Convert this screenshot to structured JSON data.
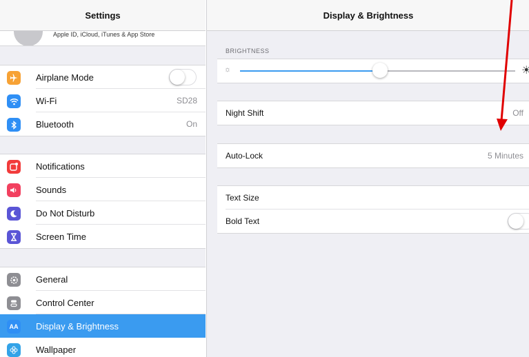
{
  "sidebar": {
    "title": "Settings",
    "profile_subtitle": "Apple ID, iCloud, iTunes & App Store",
    "groups": [
      {
        "items": [
          {
            "label": "Airplane Mode",
            "icon": "airplane-icon",
            "icon_color": "#f7a235",
            "toggle": false
          },
          {
            "label": "Wi-Fi",
            "icon": "wifi-icon",
            "icon_color": "#2f8ff5",
            "value": "SD28"
          },
          {
            "label": "Bluetooth",
            "icon": "bluetooth-icon",
            "icon_color": "#2f8ff5",
            "value": "On"
          }
        ]
      },
      {
        "items": [
          {
            "label": "Notifications",
            "icon": "notifications-icon",
            "icon_color": "#f23b3b"
          },
          {
            "label": "Sounds",
            "icon": "sounds-icon",
            "icon_color": "#f2405f"
          },
          {
            "label": "Do Not Disturb",
            "icon": "moon-icon",
            "icon_color": "#5a55d6"
          },
          {
            "label": "Screen Time",
            "icon": "hourglass-icon",
            "icon_color": "#5a55d6"
          }
        ]
      },
      {
        "items": [
          {
            "label": "General",
            "icon": "gear-icon",
            "icon_color": "#8e8e93"
          },
          {
            "label": "Control Center",
            "icon": "switches-icon",
            "icon_color": "#8e8e93"
          },
          {
            "label": "Display & Brightness",
            "icon": "text-size-icon",
            "icon_color": "#2f8ff5",
            "selected": true,
            "icon_glyph": "AA"
          },
          {
            "label": "Wallpaper",
            "icon": "flower-icon",
            "icon_color": "#33a3e8"
          }
        ]
      }
    ]
  },
  "detail": {
    "title": "Display & Brightness",
    "brightness_label": "BRIGHTNESS",
    "brightness_level": 0.51,
    "night_shift": {
      "label": "Night Shift",
      "value": "Off"
    },
    "auto_lock": {
      "label": "Auto-Lock",
      "value": "5 Minutes"
    },
    "text_size": {
      "label": "Text Size"
    },
    "bold_text": {
      "label": "Bold Text",
      "toggle": false
    }
  },
  "colors": {
    "accent": "#3a9bf0",
    "annotation_arrow": "#e00000"
  }
}
